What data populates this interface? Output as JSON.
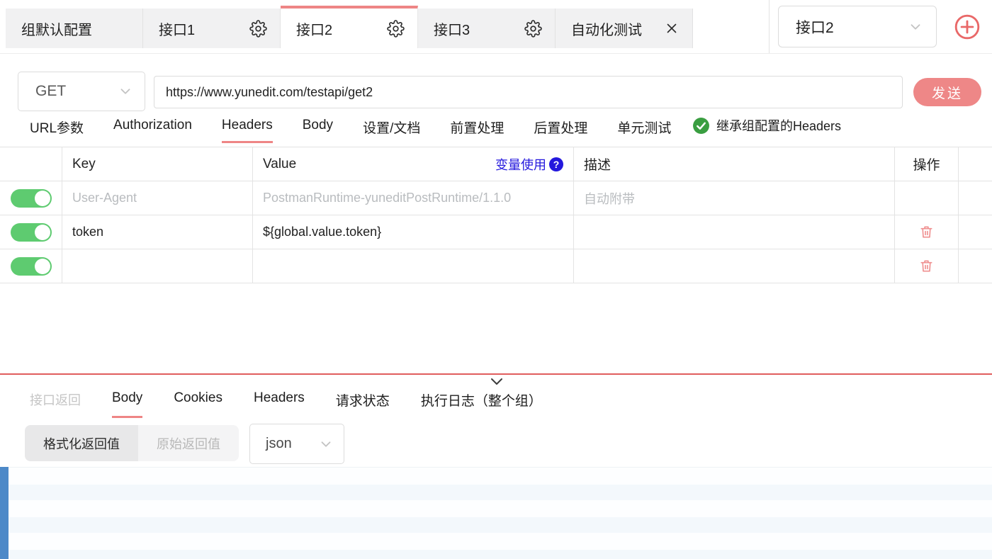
{
  "colors": {
    "accent_salmon": "#ee8585",
    "divider_red": "#e05d5d",
    "toggle_green": "#5ecb70",
    "check_green": "#3a9e41",
    "link_blue": "#2418dd",
    "gutter_blue": "#4d89c8"
  },
  "tabbar": {
    "tabs": [
      {
        "label": "组默认配置"
      },
      {
        "label": "接口1"
      },
      {
        "label": "接口2",
        "active": true
      },
      {
        "label": "接口3"
      },
      {
        "label": "自动化测试"
      }
    ],
    "group_select_value": "接口2"
  },
  "request": {
    "method": "GET",
    "url": "https://www.yunedit.com/testapi/get2",
    "send_label": "发送"
  },
  "request_tabs": [
    {
      "label": "URL参数"
    },
    {
      "label": "Authorization"
    },
    {
      "label": "Headers",
      "active": true
    },
    {
      "label": "Body"
    },
    {
      "label": "设置/文档"
    },
    {
      "label": "前置处理"
    },
    {
      "label": "后置处理"
    },
    {
      "label": "单元测试"
    }
  ],
  "inherit_badge": {
    "label": "继承组配置的Headers"
  },
  "headers_table": {
    "col_key": "Key",
    "col_value": "Value",
    "var_link": "变量使用",
    "help_mark": "?",
    "col_desc": "描述",
    "col_action": "操作",
    "rows": [
      {
        "key": "User-Agent",
        "value": "PostmanRuntime-yuneditPostRuntime/1.1.0",
        "desc": "自动附带"
      },
      {
        "key": "token",
        "value": "${global.value.token}",
        "desc": ""
      },
      {
        "key": "",
        "value": "",
        "desc": ""
      }
    ]
  },
  "response": {
    "section_label": "接口返回",
    "tabs": [
      {
        "label": "Body",
        "active": true
      },
      {
        "label": "Cookies"
      },
      {
        "label": "Headers"
      },
      {
        "label": "请求状态"
      },
      {
        "label": "执行日志（整个组）"
      }
    ],
    "view_modes": [
      {
        "label": "格式化返回值",
        "active": true
      },
      {
        "label": "原始返回值"
      }
    ],
    "format_select_value": "json"
  }
}
